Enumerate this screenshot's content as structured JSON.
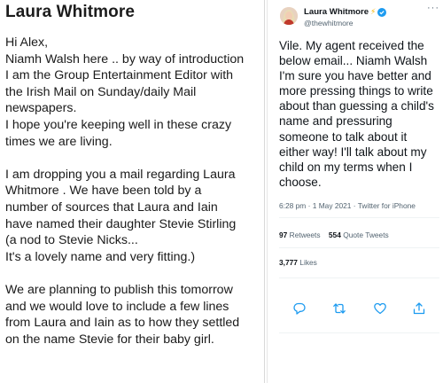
{
  "email": {
    "sender": "Laura Whitmore",
    "lines": [
      "Hi Alex,",
      "Niamh Walsh here .. by way of introduction",
      "I am the Group Entertainment Editor with",
      "the Irish Mail on Sunday/daily Mail",
      "newspapers.",
      "I hope you're keeping well in these crazy",
      "times we are living.",
      "",
      "I am dropping you a mail regarding Laura",
      "Whitmore . We have been told by a",
      "number of sources that Laura and Iain",
      "have named their daughter Stevie Stirling",
      "(a nod to Stevie Nicks...",
      "It's a lovely name and very fitting.)",
      "",
      "We are planning to publish this tomorrow",
      "and we would love to include a few lines",
      "from Laura and Iain as to how they settled",
      "on the name Stevie for their baby girl."
    ]
  },
  "tweet": {
    "author_name": "Laura Whitmore",
    "name_emoji": "⚡",
    "handle": "@thewhitmore",
    "text_lines": [
      "Vile. My agent received the",
      "below email... Niamh Walsh",
      "I'm sure you have better and",
      "more pressing things to write",
      "about than guessing a child's",
      "name and pressuring",
      "someone to talk about it",
      "either way! I'll talk about my",
      "child on my terms when I",
      "choose."
    ],
    "timestamp": "6:28 pm · 1 May 2021 · Twitter for iPhone",
    "retweets_count": "97",
    "retweets_label": "Retweets",
    "quotes_count": "554",
    "quotes_label": "Quote Tweets",
    "likes_count": "3,777",
    "likes_label": "Likes",
    "more_label": "···",
    "colors": {
      "verified": "#1d9bf0",
      "bolt": "#f5b400",
      "icon": "#1d9bf0"
    }
  }
}
